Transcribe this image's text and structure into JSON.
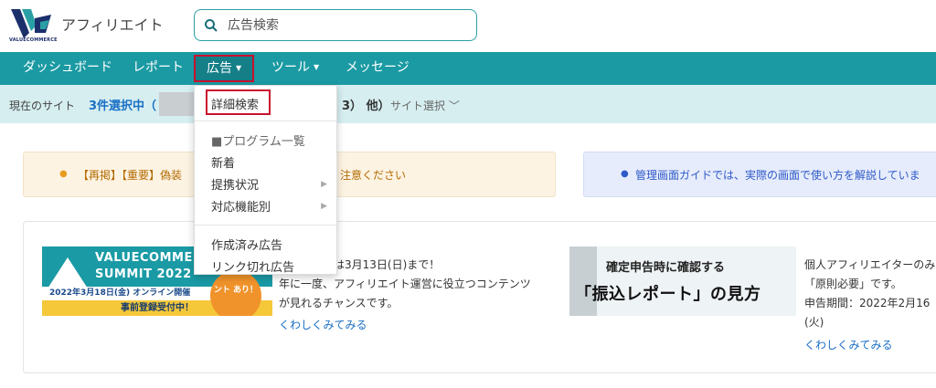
{
  "header": {
    "logo_sub": "VALUECOMMERCE",
    "brand": "アフィリエイト",
    "search_placeholder": "広告検索"
  },
  "nav": {
    "items": [
      {
        "label": "ダッシュボード"
      },
      {
        "label": "レポート"
      },
      {
        "label": "広告"
      },
      {
        "label": "ツール"
      },
      {
        "label": "メッセージ"
      }
    ]
  },
  "sitebar": {
    "current_label": "現在のサイト",
    "selected": "3件選択中（",
    "other": "3） 他）",
    "pick": "サイト選択"
  },
  "notices": {
    "n1_left": "【再掲】【重要】偽装",
    "n1_right": "注意ください",
    "n2": "管理画面ガイドでは、実際の画面で使い方を解説していま"
  },
  "articles": [
    {
      "banner_line1": "VALUECOMMERCE",
      "banner_line2": "SUMMIT 2022",
      "banner_date": "2022年3月18日(金) オンライン開催",
      "banner_reg": "事前登録受付中！",
      "banner_badge": "ント あり！",
      "text_line1": "】視聴応募は3月13日(日)まで！",
      "text_line2": "年に一度、アフィリエイト運営に役立つコンテンツ",
      "text_line3": "が見れるチャンスです。",
      "more": "くわしくみてみる"
    },
    {
      "banner_line1": "確定申告時に確認する",
      "banner_line2": "「振込レポート」の見方",
      "text_line1": "個人アフィリエイターのみ",
      "text_line2": "「原則必要」です。",
      "text_line3": "申告期間：2022年2月16",
      "text_line4": "(火)",
      "more": "くわしくみてみる"
    }
  ],
  "dropdown": {
    "detail_search": "詳細検索",
    "program_list": "■プログラム一覧",
    "new": "新着",
    "status": "提携状況",
    "by_feature": "対応機能別",
    "created": "作成済み広告",
    "broken": "リンク切れ広告"
  },
  "colors": {
    "nav_bg": "#1b9aa3",
    "highlight": "#c8102e",
    "link": "#1a6fc4"
  }
}
